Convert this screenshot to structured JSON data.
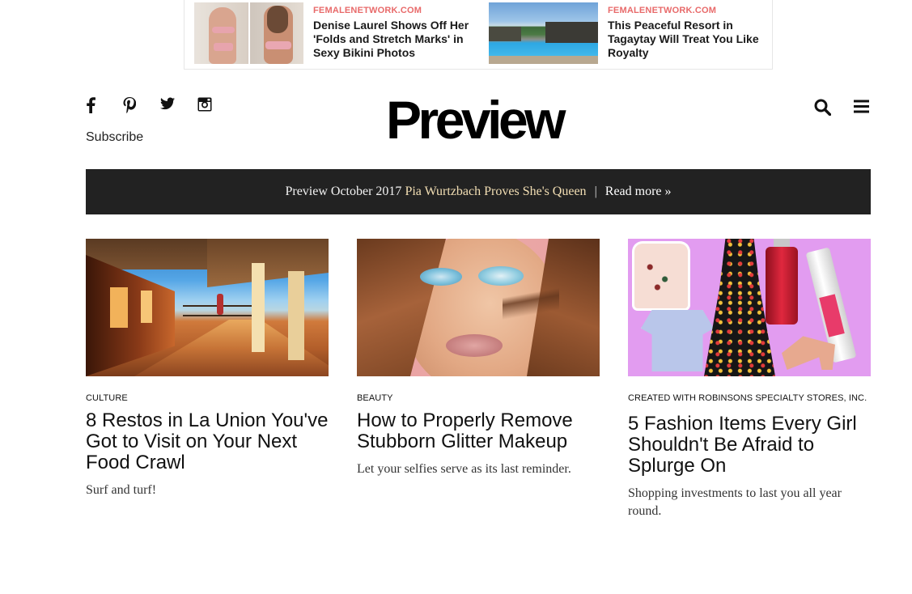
{
  "ads": [
    {
      "source": "FEMALENETWORK.COM",
      "title": "Denise Laurel Shows Off Her 'Folds and Stretch Marks' in Sexy Bikini Photos"
    },
    {
      "source": "FEMALENETWORK.COM",
      "title": "This Peaceful Resort in Tagaytay Will Treat You Like Royalty"
    }
  ],
  "header": {
    "logo": "Preview",
    "subscribe_label": "Subscribe",
    "social_icons": [
      "facebook-icon",
      "pinterest-icon",
      "twitter-icon",
      "instagram-icon"
    ]
  },
  "banner": {
    "prefix": "Preview October 2017",
    "highlight": "Pia Wurtzbach Proves She's Queen",
    "separator": "|",
    "link": "Read more »"
  },
  "articles": [
    {
      "category": "CULTURE",
      "title": "8 Restos in La Union You've Got to Visit on Your Next Food Crawl",
      "dek": "Surf and turf!"
    },
    {
      "category": "BEAUTY",
      "title": "How to Properly Remove Stubborn Glitter Makeup",
      "dek": "Let your selfies serve as its last reminder."
    },
    {
      "category": "CREATED WITH ROBINSONS SPECIALTY STORES, INC.",
      "title": "5 Fashion Items Every Girl Shouldn't Be Afraid to Splurge On",
      "dek": "Shopping investments to last you all year round."
    }
  ],
  "colors": {
    "ad_source": "#e86a6a",
    "banner_bg": "#222222",
    "banner_highlight": "#f3dfb4"
  }
}
